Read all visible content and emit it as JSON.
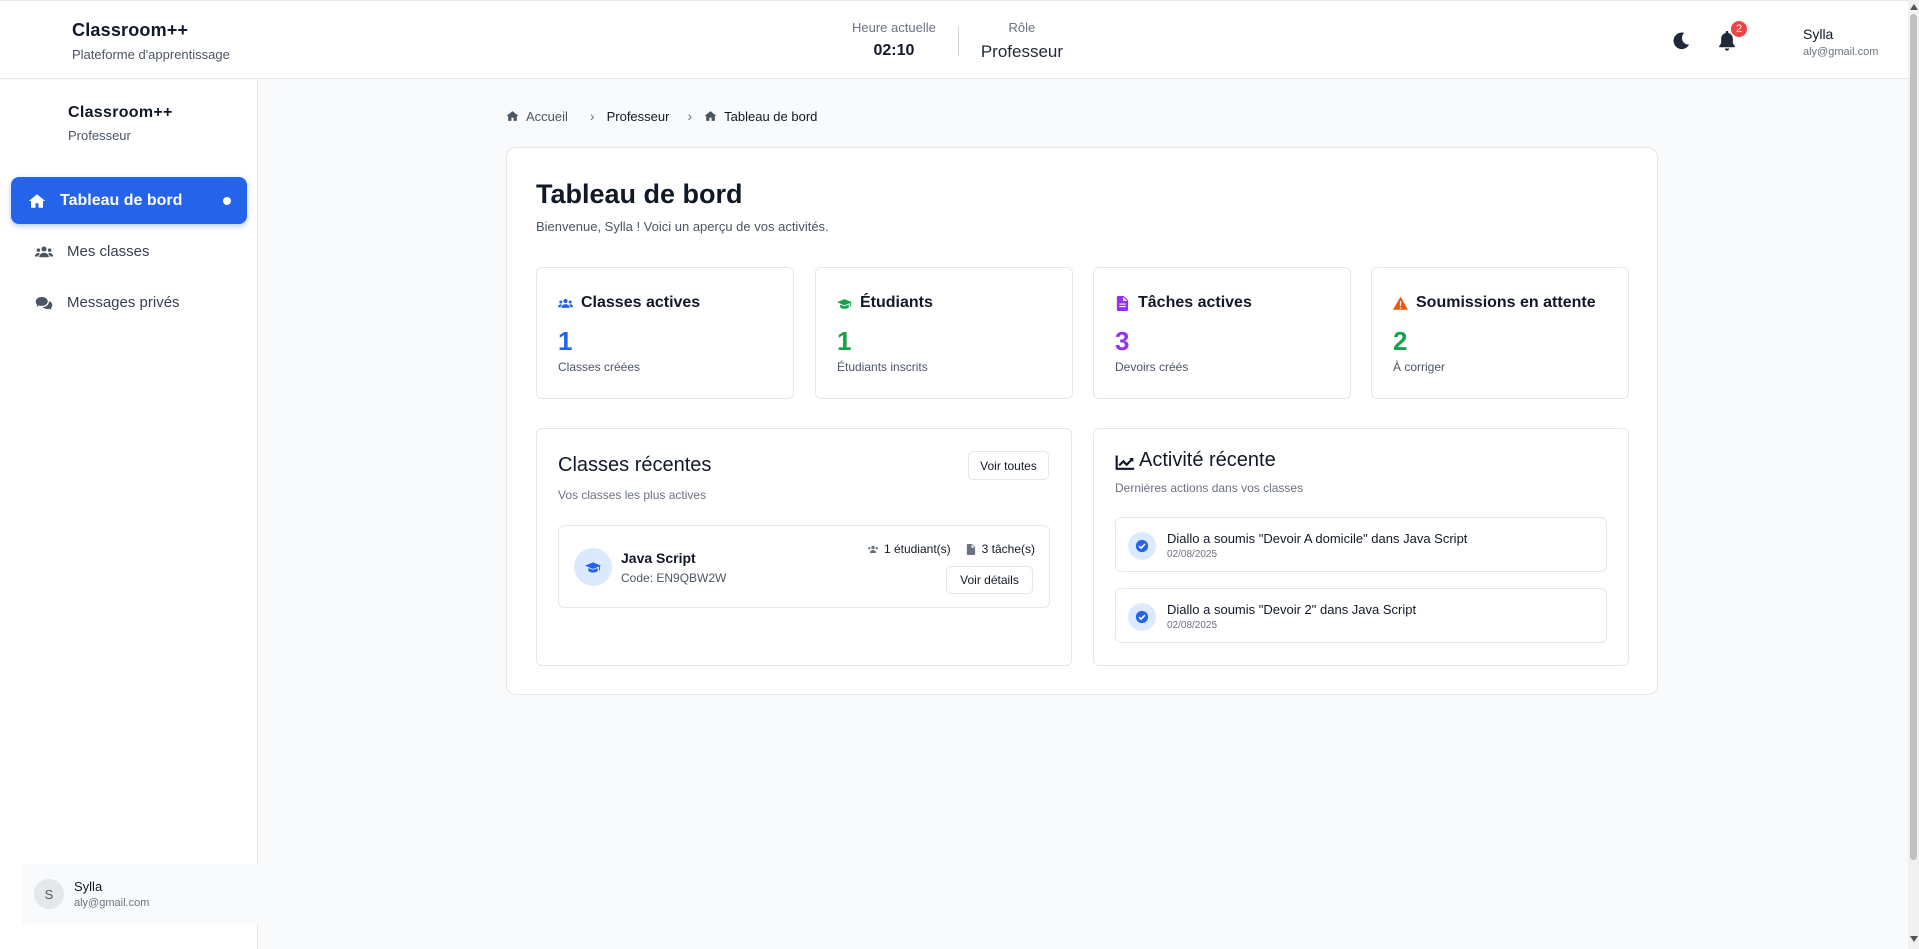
{
  "header": {
    "brand_title": "Classroom++",
    "brand_subtitle": "Plateforme d'apprentissage",
    "time_label": "Heure actuelle",
    "time_value": "02:10",
    "role_label": "Rôle",
    "role_value": "Professeur",
    "notification_count": "2",
    "user_name": "Sylla",
    "user_email": "aly@gmail.com"
  },
  "sidebar": {
    "brand_title": "Classroom++",
    "brand_role": "Professeur",
    "items": [
      {
        "label": "Tableau de bord",
        "icon": "home-icon",
        "active": true
      },
      {
        "label": "Mes classes",
        "icon": "users-icon",
        "active": false
      },
      {
        "label": "Messages privés",
        "icon": "comments-icon",
        "active": false
      }
    ],
    "user": {
      "initial": "S",
      "name": "Sylla",
      "email": "aly@gmail.com"
    }
  },
  "breadcrumb": [
    {
      "label": "Accueil",
      "icon": "home-icon"
    },
    {
      "label": "Professeur"
    },
    {
      "label": "Tableau de bord",
      "icon": "home-icon"
    }
  ],
  "main": {
    "title": "Tableau de bord",
    "subtitle": "Bienvenue, Sylla ! Voici un aperçu de vos activités.",
    "stats": [
      {
        "title": "Classes actives",
        "value": "1",
        "caption": "Classes créées",
        "color": "#2563eb",
        "icon": "users-icon"
      },
      {
        "title": "Étudiants",
        "value": "1",
        "caption": "Étudiants inscrits",
        "color": "#16a34a",
        "icon": "graduation-cap-icon"
      },
      {
        "title": "Tâches actives",
        "value": "3",
        "caption": "Devoirs créés",
        "color": "#9333ea",
        "icon": "file-icon"
      },
      {
        "title": "Soumissions en attente",
        "value": "2",
        "caption": "À corriger",
        "color": "#16a34a",
        "icon": "warning-icon"
      }
    ],
    "recent_classes": {
      "title": "Classes récentes",
      "subtitle": "Vos classes les plus actives",
      "view_all_label": "Voir toutes",
      "items": [
        {
          "name": "Java Script",
          "code": "Code: EN9QBW2W",
          "students": "1 étudiant(s)",
          "tasks": "3 tâche(s)",
          "details_label": "Voir détails"
        }
      ]
    },
    "recent_activity": {
      "title": "Activité récente",
      "subtitle": "Dernières actions dans vos classes",
      "items": [
        {
          "text": "Diallo a soumis \"Devoir A domicile\" dans Java Script",
          "date": "02/08/2025"
        },
        {
          "text": "Diallo a soumis \"Devoir 2\" dans Java Script",
          "date": "02/08/2025"
        }
      ]
    }
  }
}
